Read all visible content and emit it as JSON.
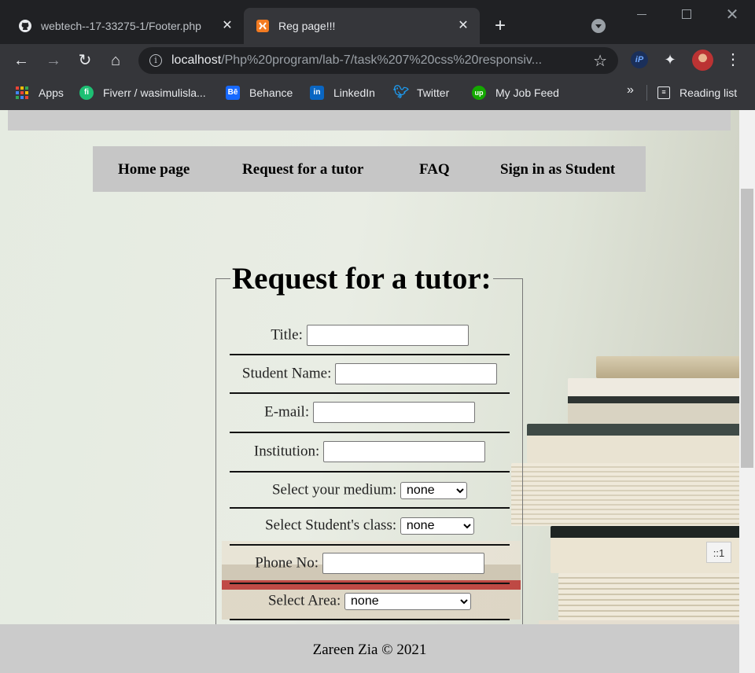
{
  "browser": {
    "tabs": [
      {
        "title": "webtech--17-33275-1/Footer.php",
        "favicon": "github-icon"
      },
      {
        "title": "Reg page!!!",
        "favicon": "xampp-icon"
      }
    ],
    "address": {
      "host": "localhost",
      "path": "/Php%20program/lab-7/task%207%20css%20responsiv..."
    },
    "bookmarks": [
      {
        "label": "Apps",
        "icon": "apps-grid-icon"
      },
      {
        "label": "Fiverr / wasimulisla...",
        "icon": "fiverr-icon"
      },
      {
        "label": "Behance",
        "icon": "behance-icon"
      },
      {
        "label": "LinkedIn",
        "icon": "linkedin-icon"
      },
      {
        "label": "Twitter",
        "icon": "twitter-icon"
      },
      {
        "label": "My Job Feed",
        "icon": "upwork-icon"
      }
    ],
    "more_bookmarks": "»",
    "reading_list": "Reading list",
    "ext_ip": "iP"
  },
  "page": {
    "nav": [
      "Home page",
      "Request for a tutor",
      "FAQ",
      "Sign in as Student"
    ],
    "form_title": "Request for a tutor:",
    "fields": {
      "title": {
        "label": "Title:",
        "value": ""
      },
      "student_name": {
        "label": "Student Name:",
        "value": ""
      },
      "email": {
        "label": "E-mail:",
        "value": ""
      },
      "institution": {
        "label": "Institution:",
        "value": ""
      },
      "medium": {
        "label": "Select your medium:",
        "selected": "none"
      },
      "student_class": {
        "label": "Select Student's class:",
        "selected": "none"
      },
      "phone": {
        "label": "Phone No:",
        "value": ""
      },
      "area": {
        "label": "Select Area:",
        "selected": "none"
      }
    },
    "footer": "Zareen Zia © 2021",
    "corner_badge": "::1"
  },
  "colors": {
    "chrome_dark": "#202124",
    "chrome_toolbar": "#35363a",
    "nav_bg": "#c6c6c6",
    "footer_bg": "#cbcbcb"
  }
}
